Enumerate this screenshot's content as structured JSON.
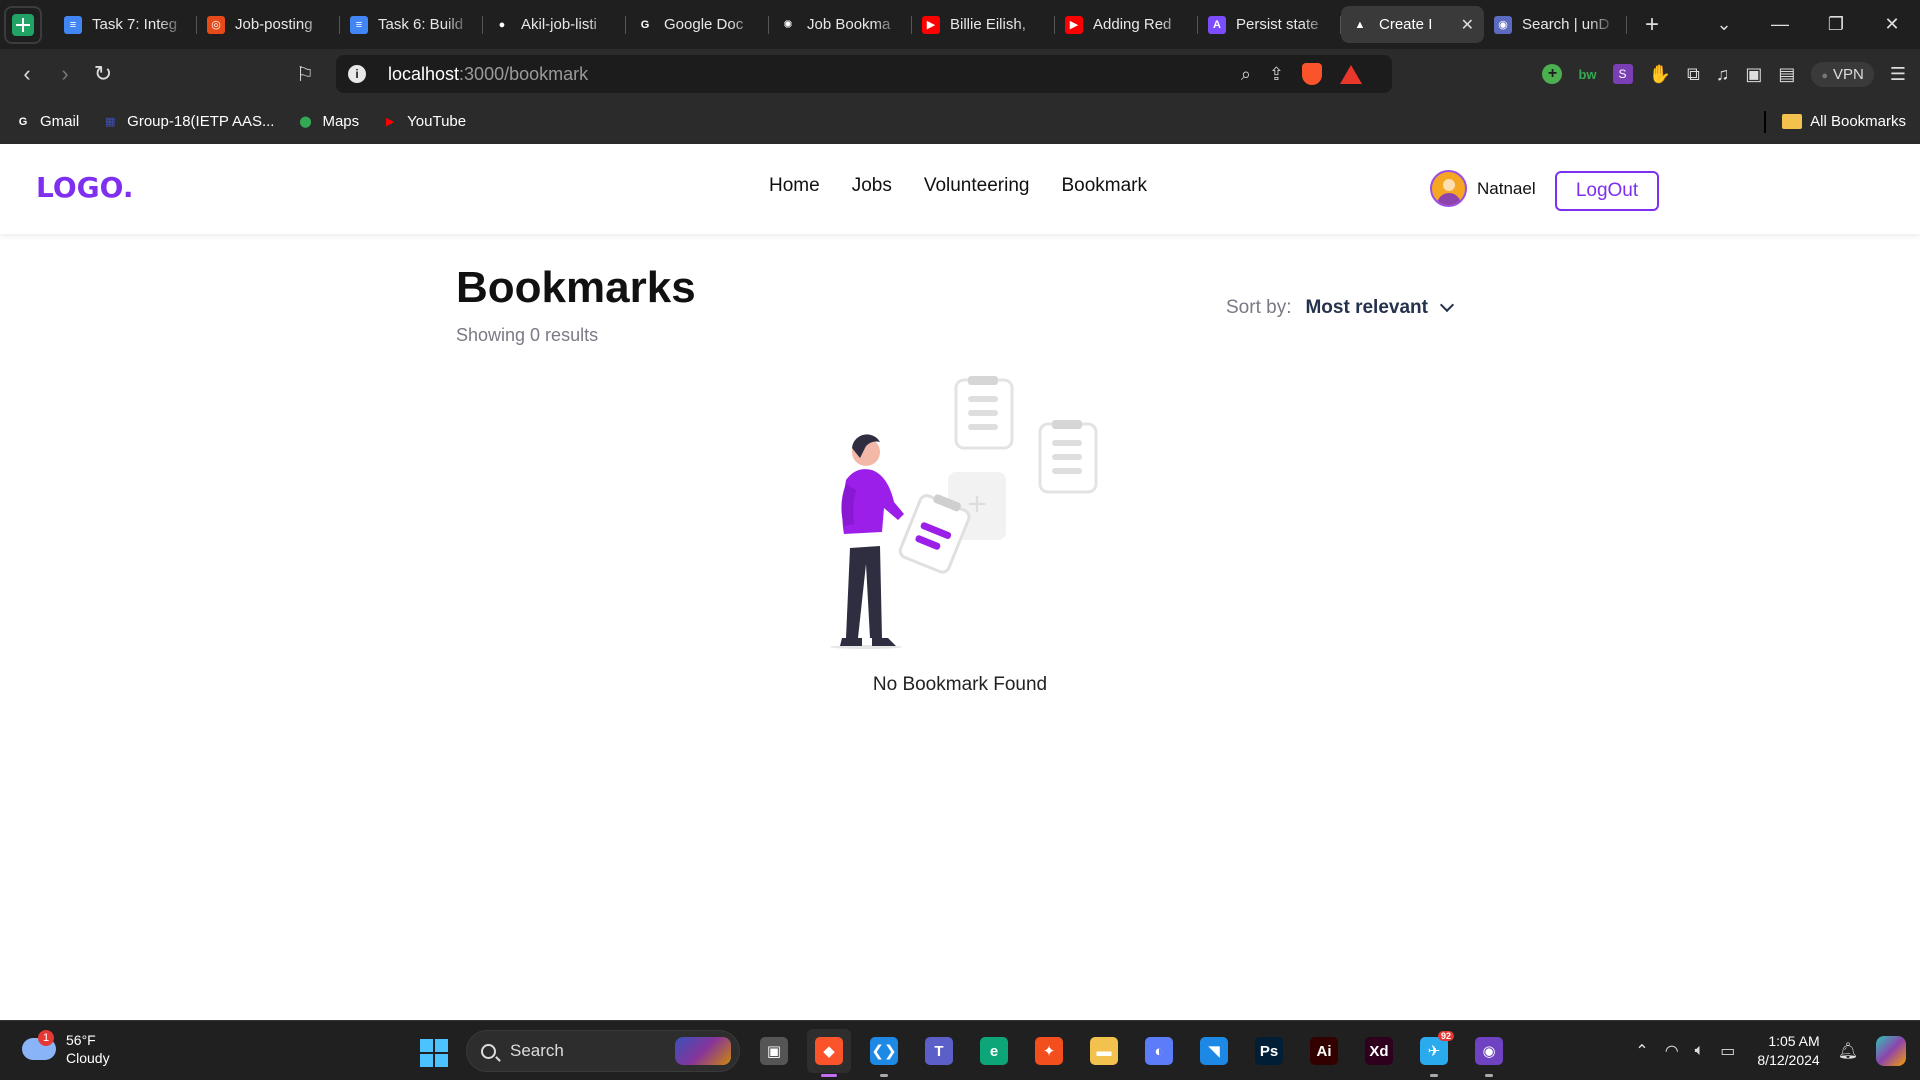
{
  "browser": {
    "tabs": [
      {
        "title": "Task 7: Integ",
        "fav_color": "#4285f4",
        "fav_glyph": "≡"
      },
      {
        "title": "Job-posting",
        "fav_color": "#e64a19",
        "fav_glyph": "◎"
      },
      {
        "title": "Task 6: Build",
        "fav_color": "#4285f4",
        "fav_glyph": "≡"
      },
      {
        "title": "Akil-job-listi",
        "fav_color": "#ffffff",
        "fav_glyph": "●"
      },
      {
        "title": "Google Doc",
        "fav_color": "#ffffff",
        "fav_glyph": "G"
      },
      {
        "title": "Job Bookma",
        "fav_color": "#ffffff",
        "fav_glyph": "✺"
      },
      {
        "title": "Billie Eilish,",
        "fav_color": "#ff0000",
        "fav_glyph": "▶"
      },
      {
        "title": "Adding Red",
        "fav_color": "#ff0000",
        "fav_glyph": "▶"
      },
      {
        "title": "Persist state",
        "fav_color": "#7c4dff",
        "fav_glyph": "A"
      },
      {
        "title": "Create I",
        "fav_color": "#ffffff",
        "fav_glyph": "▲",
        "active": true
      },
      {
        "title": "Search | unD",
        "fav_color": "#5c6bc0",
        "fav_glyph": "◉"
      }
    ],
    "url_host": "localhost",
    "url_path": ":3000/bookmark",
    "vpn_label": "VPN",
    "bookmarks": [
      {
        "label": "Gmail",
        "color": "#ffffff",
        "glyph": "G"
      },
      {
        "label": "Group-18(IETP AAS...",
        "color": "#3f51b5",
        "glyph": "▦"
      },
      {
        "label": "Maps",
        "color": "#34a853",
        "glyph": "⬤"
      },
      {
        "label": "YouTube",
        "color": "#ff0000",
        "glyph": "▶"
      }
    ],
    "all_bookmarks_label": "All Bookmarks"
  },
  "site": {
    "logo": "LOGO.",
    "nav": [
      "Home",
      "Jobs",
      "Volunteering",
      "Bookmark"
    ],
    "user_name": "Natnael",
    "logout_label": "LogOut",
    "brand_color": "#7e2ff0"
  },
  "page": {
    "title": "Bookmarks",
    "results_text": "Showing 0 results",
    "sort_label": "Sort by:",
    "sort_value": "Most relevant",
    "empty_text": "No Bookmark Found"
  },
  "taskbar": {
    "weather_temp": "56°F",
    "weather_desc": "Cloudy",
    "weather_badge": "1",
    "search_label": "Search",
    "telegram_badge": "92",
    "time": "1:05 AM",
    "date": "8/12/2024",
    "apps": [
      {
        "name": "task-view",
        "label": "▣",
        "bg": "#555555"
      },
      {
        "name": "brave",
        "label": "◆",
        "bg": "#fb542b",
        "active": true
      },
      {
        "name": "vscode",
        "label": "❮❯",
        "bg": "#1e88e5"
      },
      {
        "name": "teams",
        "label": "T",
        "bg": "#5b5fc7"
      },
      {
        "name": "edge",
        "label": "e",
        "bg": "#0ca678"
      },
      {
        "name": "figma",
        "label": "✦",
        "bg": "#f24e1e"
      },
      {
        "name": "file-explorer",
        "label": "▬",
        "bg": "#f2c14e"
      },
      {
        "name": "app-blue",
        "label": "◐",
        "bg": "#5c7cfa"
      },
      {
        "name": "framer",
        "label": "◥",
        "bg": "#1e88e5"
      },
      {
        "name": "photoshop",
        "label": "Ps",
        "bg": "#001e36"
      },
      {
        "name": "illustrator",
        "label": "Ai",
        "bg": "#330000"
      },
      {
        "name": "xd",
        "label": "Xd",
        "bg": "#2e001e"
      },
      {
        "name": "telegram",
        "label": "✈",
        "bg": "#2aabee"
      },
      {
        "name": "github-desktop",
        "label": "◉",
        "bg": "#6f42c1"
      }
    ]
  }
}
